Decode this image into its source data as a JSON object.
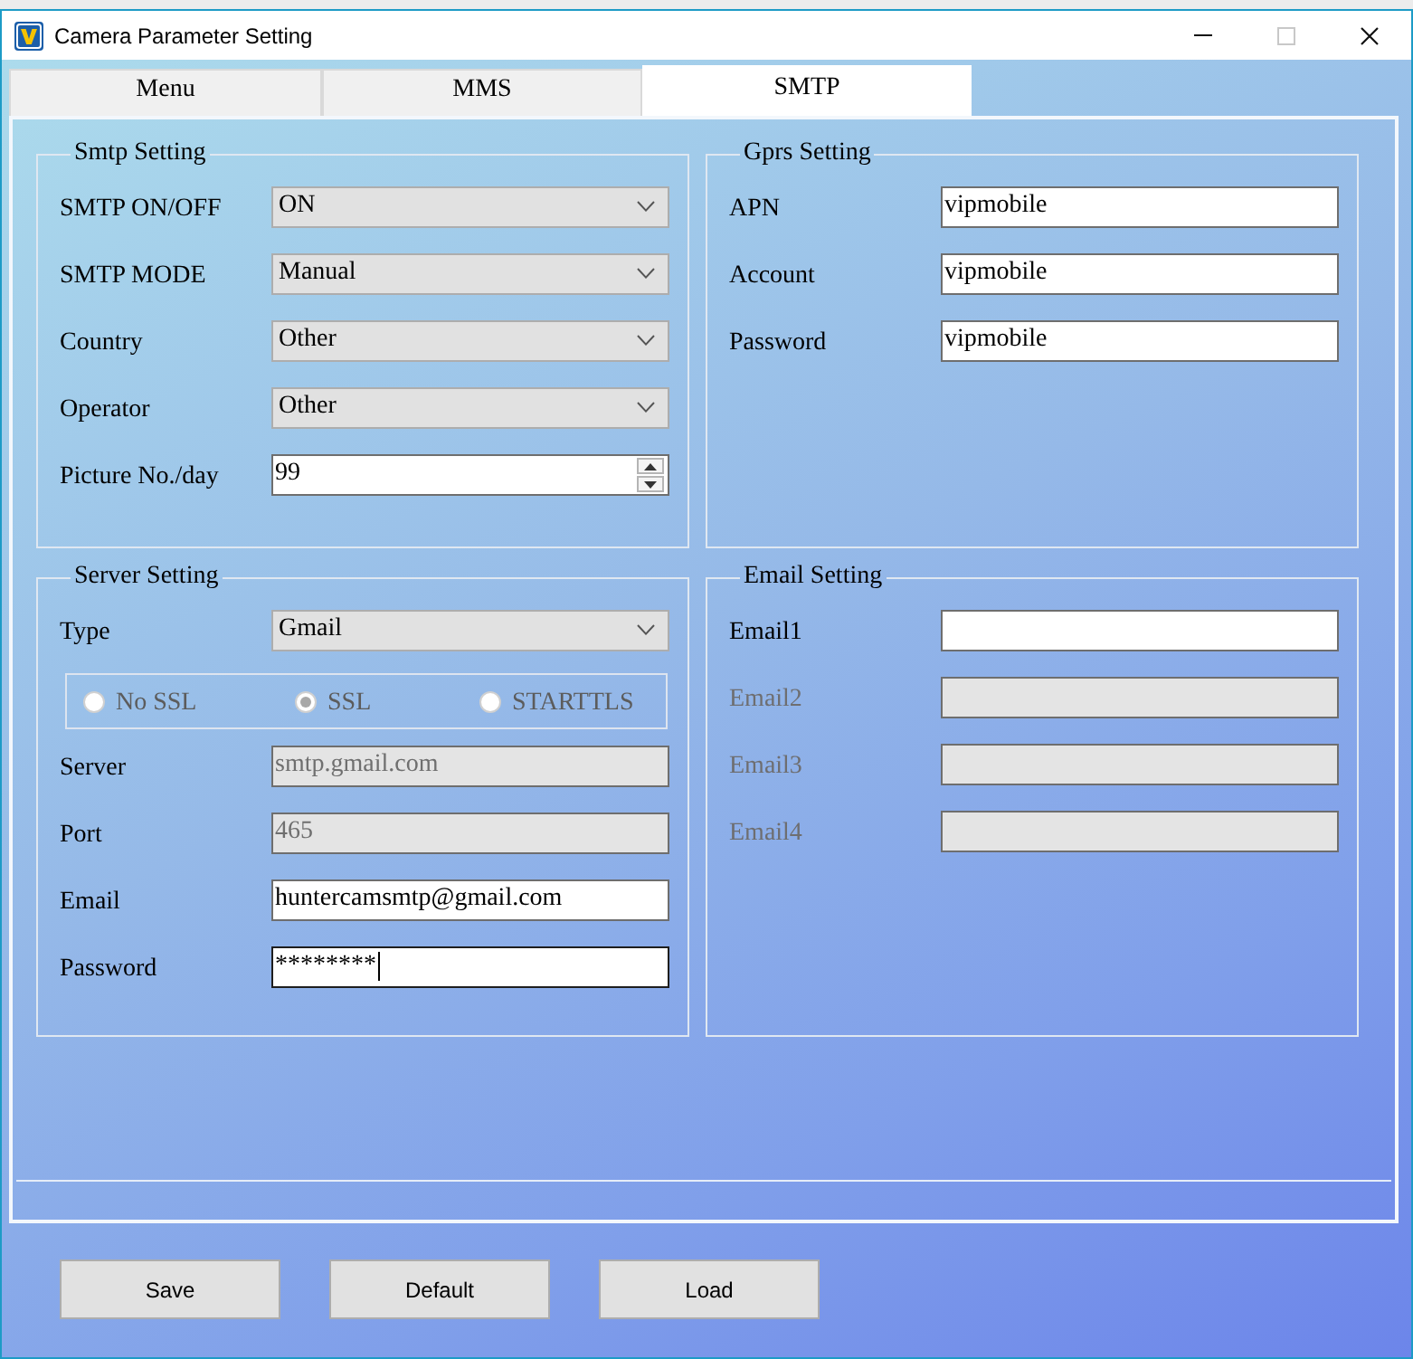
{
  "window": {
    "title": "Camera Parameter Setting",
    "controls": [
      {
        "kind": "minimize",
        "disabled": false
      },
      {
        "kind": "maximize",
        "disabled": true
      },
      {
        "kind": "close",
        "disabled": false
      }
    ]
  },
  "tabs": [
    {
      "label": "Menu",
      "selected": false
    },
    {
      "label": "MMS",
      "selected": false
    },
    {
      "label": "SMTP",
      "selected": true
    }
  ],
  "smtp_setting": {
    "title": "Smtp Setting",
    "rows": [
      {
        "label": "SMTP ON/OFF",
        "kind": "combo",
        "value": "ON"
      },
      {
        "label": "SMTP MODE",
        "kind": "combo",
        "value": "Manual"
      },
      {
        "label": "Country",
        "kind": "combo",
        "value": "Other"
      },
      {
        "label": "Operator",
        "kind": "combo",
        "value": "Other"
      },
      {
        "label": "Picture No./day",
        "kind": "spinner",
        "value": "99"
      }
    ]
  },
  "gprs_setting": {
    "title": "Gprs Setting",
    "rows": [
      {
        "label": "APN",
        "value": "vipmobile"
      },
      {
        "label": "Account",
        "value": "vipmobile"
      },
      {
        "label": "Password",
        "value": "vipmobile"
      }
    ]
  },
  "server_setting": {
    "title": "Server Setting",
    "type": {
      "label": "Type",
      "value": "Gmail"
    },
    "encryption": {
      "disabled": true,
      "options": [
        {
          "label": "No SSL",
          "selected": false
        },
        {
          "label": "SSL",
          "selected": true
        },
        {
          "label": "STARTTLS",
          "selected": false
        }
      ]
    },
    "rows": [
      {
        "label": "Server",
        "value": "smtp.gmail.com",
        "disabled": true,
        "focused": false
      },
      {
        "label": "Port",
        "value": "465",
        "disabled": true,
        "focused": false
      },
      {
        "label": "Email",
        "value": "huntercamsmtp@gmail.com",
        "disabled": false,
        "focused": false
      },
      {
        "label": "Password",
        "value": "********",
        "disabled": false,
        "focused": true
      }
    ]
  },
  "email_setting": {
    "title": "Email Setting",
    "rows": [
      {
        "label": "Email1",
        "disabled": false
      },
      {
        "label": "Email2",
        "disabled": true
      },
      {
        "label": "Email3",
        "disabled": true
      },
      {
        "label": "Email4",
        "disabled": true
      }
    ]
  },
  "buttons": [
    {
      "label": "Save"
    },
    {
      "label": "Default"
    },
    {
      "label": "Load"
    }
  ]
}
